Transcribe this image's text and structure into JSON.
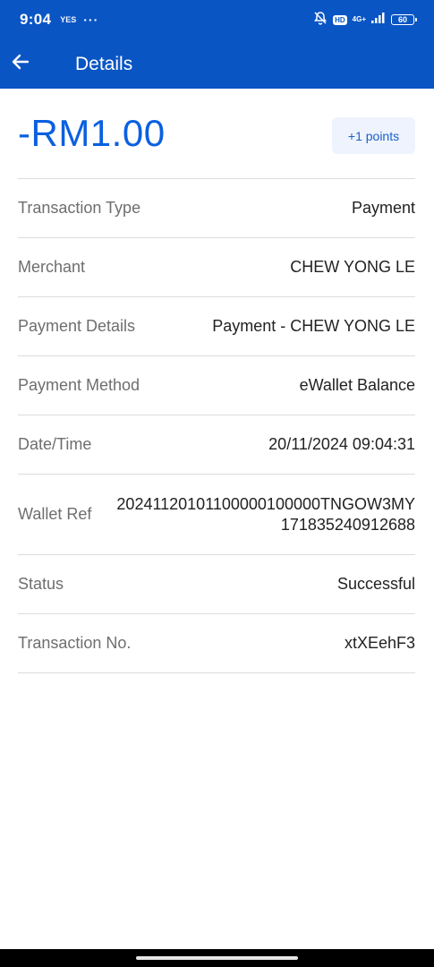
{
  "status_bar": {
    "time": "9:04",
    "sim_label": "YES",
    "more": "···",
    "hd": "HD",
    "network": "4G+",
    "battery": "60"
  },
  "header": {
    "title": "Details",
    "back_icon": "arrow-left-icon",
    "background_color": "#0a55c4"
  },
  "amount": {
    "value": "-RM1.00",
    "color": "#0a60e0",
    "points": "+1 points"
  },
  "details": [
    {
      "label": "Transaction Type",
      "value": "Payment"
    },
    {
      "label": "Merchant",
      "value": "CHEW YONG LE"
    },
    {
      "label": "Payment Details",
      "value": "Payment - CHEW YONG LE"
    },
    {
      "label": "Payment Method",
      "value": "eWallet Balance"
    },
    {
      "label": "Date/Time",
      "value": "20/11/2024 09:04:31"
    },
    {
      "label": "Wallet Ref",
      "value": "20241120101100000100000TNGOW3MY171835240912688"
    },
    {
      "label": "Status",
      "value": "Successful"
    },
    {
      "label": "Transaction No.",
      "value": "xtXEehF3"
    }
  ]
}
